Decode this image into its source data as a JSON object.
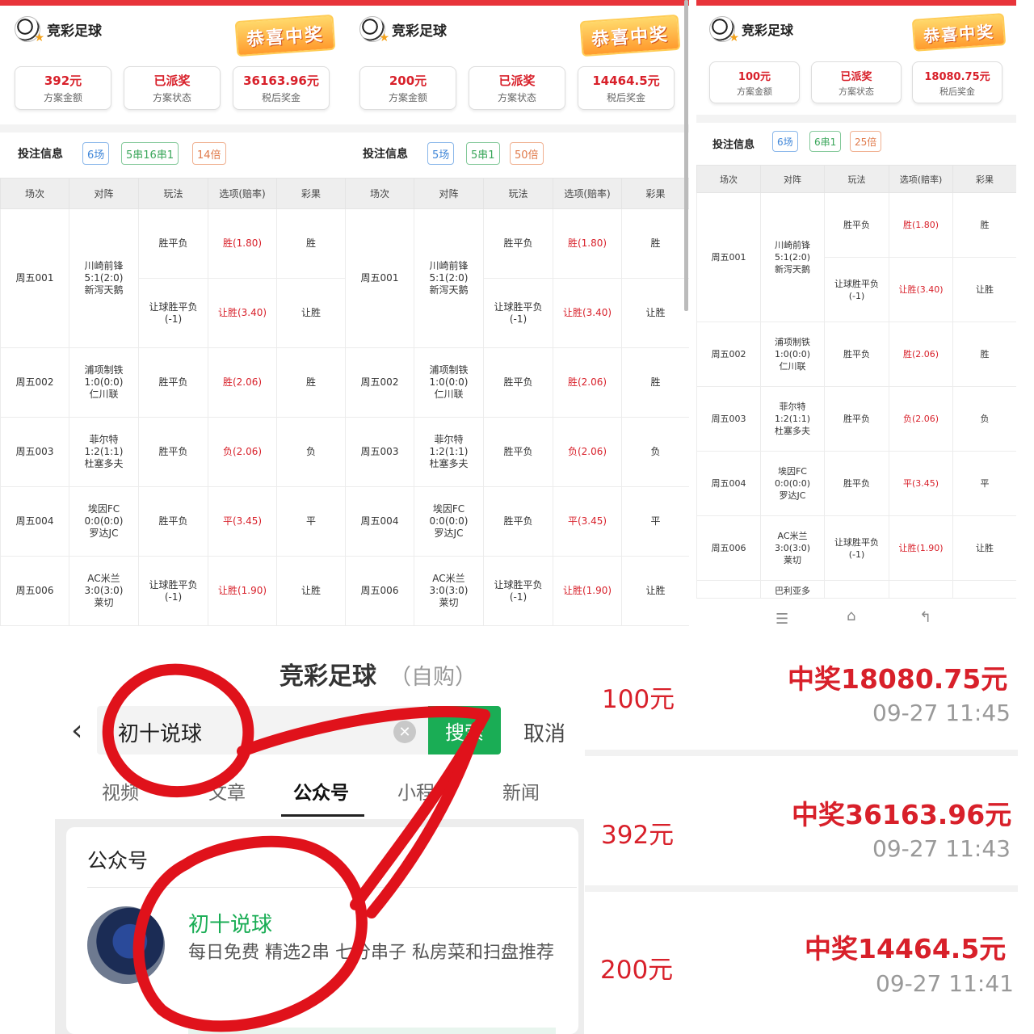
{
  "app": {
    "title": "竞彩足球",
    "stamp": "恭喜中奖",
    "bet_info_label": "投注信息"
  },
  "colors": {
    "accent": "#d8202a",
    "brand_green": "#1aad55",
    "top_bar": "#e8343a"
  },
  "table_headers": [
    "场次",
    "对阵",
    "玩法",
    "选项(赔率)",
    "彩果"
  ],
  "slips": [
    {
      "stats": [
        {
          "value": "392元",
          "label": "方案金额"
        },
        {
          "value": "已派奖",
          "label": "方案状态"
        },
        {
          "value": "36163.96元",
          "label": "税后奖金"
        }
      ],
      "chips": [
        "6场",
        "5串16串1",
        "14倍"
      ]
    },
    {
      "stats": [
        {
          "value": "200元",
          "label": "方案金额"
        },
        {
          "value": "已派奖",
          "label": "方案状态"
        },
        {
          "value": "14464.5元",
          "label": "税后奖金"
        }
      ],
      "chips": [
        "5场",
        "5串1",
        "50倍"
      ]
    },
    {
      "stats": [
        {
          "value": "100元",
          "label": "方案金额"
        },
        {
          "value": "已派奖",
          "label": "方案状态"
        },
        {
          "value": "18080.75元",
          "label": "税后奖金"
        }
      ],
      "chips": [
        "6场",
        "6串1",
        "25倍"
      ]
    }
  ],
  "matches": {
    "m001": {
      "no": "周五001",
      "home": "川崎前锋",
      "score": "5:1(2:0)",
      "away": "新泻天鹅",
      "play1": "胜平负",
      "odds1": "胜(1.80)",
      "res1": "胜",
      "play2a": "让球胜平负",
      "play2b": "(-1)",
      "odds2": "让胜(3.40)",
      "res2": "让胜"
    },
    "m002": {
      "no": "周五002",
      "home": "浦项制铁",
      "score": "1:0(0:0)",
      "away": "仁川联",
      "play": "胜平负",
      "odds": "胜(2.06)",
      "res": "胜"
    },
    "m003": {
      "no": "周五003",
      "home": "菲尔特",
      "score": "1:2(1:1)",
      "away": "杜塞多夫",
      "play": "胜平负",
      "odds": "负(2.06)",
      "res": "负"
    },
    "m004": {
      "no": "周五004",
      "home": "埃因FC",
      "score": "0:0(0:0)",
      "away": "罗达JC",
      "play": "胜平负",
      "odds": "平(3.45)",
      "res": "平"
    },
    "m006": {
      "no": "周五006",
      "home": "AC米兰",
      "score": "3:0(3:0)",
      "away": "莱切",
      "play_a": "让球胜平负",
      "play_b": "(-1)",
      "odds": "让胜(1.90)",
      "res": "让胜"
    },
    "cut_home": "巴利亚多"
  },
  "nav_icons": [
    "menu-icon",
    "home-icon",
    "back-icon"
  ],
  "search": {
    "title": "竞彩足球",
    "subtitle": "（自购）",
    "query": "初十说球",
    "button": "搜索",
    "cancel": "取消",
    "tabs": [
      "视频",
      "文章",
      "公众号",
      "小程序",
      "新闻"
    ],
    "section": "公众号",
    "account_name": "初十说球",
    "account_desc": "每日免费 精选2串 七分串子 私房菜和扫盘推荐"
  },
  "prizes": [
    {
      "amount": "100元",
      "win": "中奖18080.75元",
      "time": "09-27 11:45"
    },
    {
      "amount": "392元",
      "win": "中奖36163.96元",
      "time": "09-27 11:43"
    },
    {
      "amount": "200元",
      "win": "中奖14464.5元",
      "time": "09-27 11:41"
    }
  ]
}
